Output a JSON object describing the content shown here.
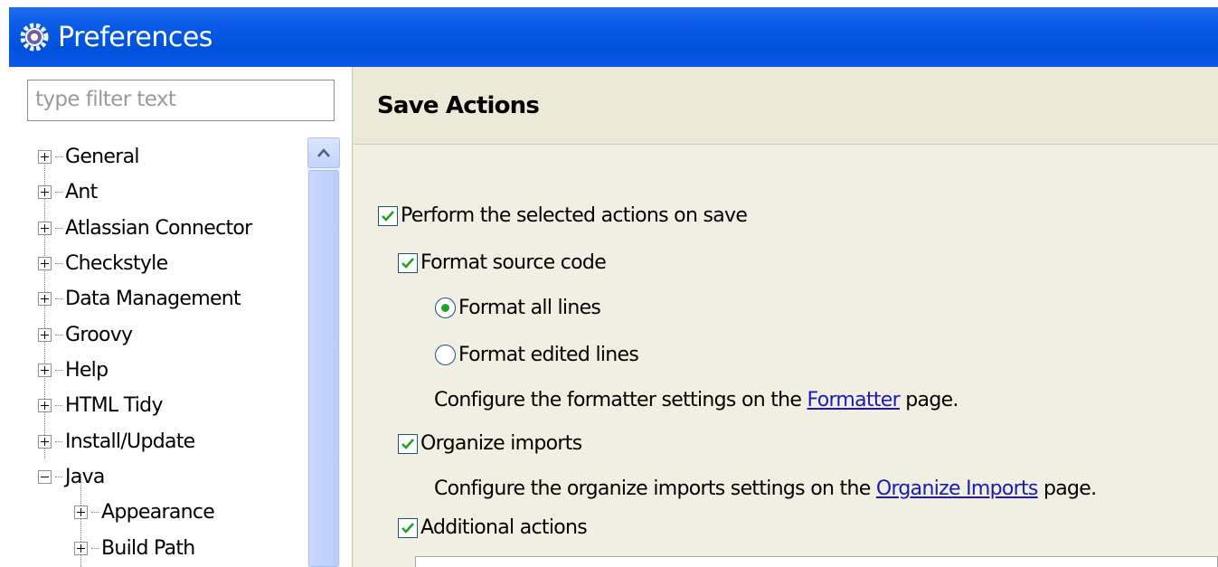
{
  "window": {
    "title": "Preferences",
    "icon": "eclipse-gear-icon"
  },
  "filter": {
    "placeholder": "type filter text"
  },
  "tree": {
    "items": [
      {
        "label": "General",
        "state": "collapsed"
      },
      {
        "label": "Ant",
        "state": "collapsed"
      },
      {
        "label": "Atlassian Connector",
        "state": "collapsed"
      },
      {
        "label": "Checkstyle",
        "state": "collapsed"
      },
      {
        "label": "Data Management",
        "state": "collapsed"
      },
      {
        "label": "Groovy",
        "state": "collapsed"
      },
      {
        "label": "Help",
        "state": "collapsed"
      },
      {
        "label": "HTML Tidy",
        "state": "collapsed"
      },
      {
        "label": "Install/Update",
        "state": "collapsed"
      },
      {
        "label": "Java",
        "state": "expanded"
      },
      {
        "label": "Appearance",
        "state": "collapsed"
      },
      {
        "label": "Build Path",
        "state": "collapsed"
      }
    ]
  },
  "page": {
    "title": "Save Actions",
    "perform_on_save": {
      "label": "Perform the selected actions on save",
      "checked": true
    },
    "format_source": {
      "label": "Format source code",
      "checked": true
    },
    "format_all_lines": {
      "label": "Format all lines",
      "selected": true
    },
    "format_edited_lines": {
      "label": "Format edited lines",
      "selected": false
    },
    "formatter_hint": {
      "prefix": "Configure the formatter settings on the ",
      "link": "Formatter",
      "suffix": " page."
    },
    "organize_imports": {
      "label": "Organize imports",
      "checked": true
    },
    "organize_hint": {
      "prefix": "Configure the organize imports settings on the ",
      "link": "Organize Imports",
      "suffix": " page."
    },
    "additional_actions": {
      "label": "Additional actions",
      "checked": true
    }
  },
  "colors": {
    "titlebar": "#0a5ce8",
    "check": "#21a121",
    "link": "#1a1ab8",
    "panel": "#ece9d8"
  }
}
